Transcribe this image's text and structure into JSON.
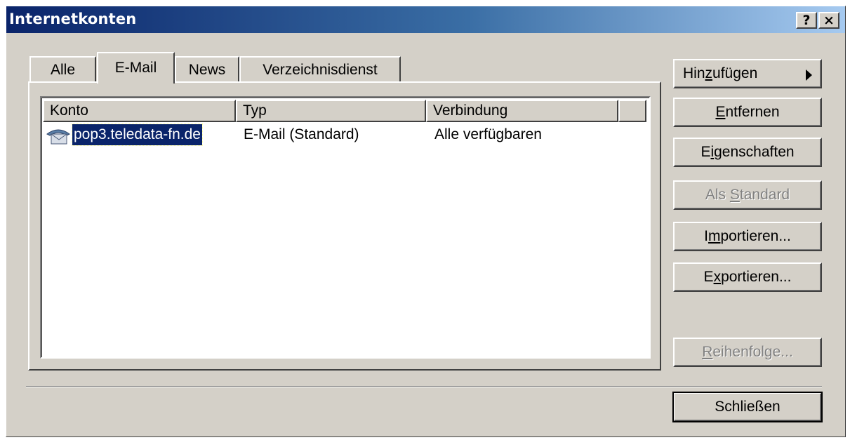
{
  "window": {
    "title": "Internetkonten"
  },
  "titlebar_buttons": {
    "help": "?",
    "close": "×"
  },
  "tabs": [
    {
      "label": "Alle"
    },
    {
      "label": "E-Mail"
    },
    {
      "label": "News"
    },
    {
      "label": "Verzeichnisdienst"
    }
  ],
  "active_tab": "E-Mail",
  "table": {
    "columns": [
      "Konto",
      "Typ",
      "Verbindung"
    ],
    "rows": [
      {
        "account": "pop3.teledata-fn.de",
        "type": "E-Mail (Standard)",
        "connection": "Alle verfügbaren",
        "icon": "mail-account-icon",
        "selected": true
      }
    ]
  },
  "buttons": {
    "add": {
      "pre": "Hin",
      "key": "z",
      "post": "ufügen"
    },
    "remove": {
      "pre": "",
      "key": "E",
      "post": "ntfernen"
    },
    "properties": {
      "pre": "E",
      "key": "i",
      "post": "genschaften"
    },
    "set_default": {
      "pre": "Als ",
      "key": "S",
      "post": "tandard",
      "disabled": true
    },
    "import": {
      "pre": "I",
      "key": "m",
      "post": "portieren..."
    },
    "export": {
      "pre": "E",
      "key": "x",
      "post": "portieren..."
    },
    "order": {
      "pre": "",
      "key": "R",
      "post": "eihenfolge...",
      "disabled": true
    },
    "close": {
      "label": "Schließen"
    }
  },
  "colors": {
    "titlebar_start": "#0a246a",
    "titlebar_end": "#a6caf0",
    "face": "#d4d0c8",
    "selection": "#0a246a"
  }
}
